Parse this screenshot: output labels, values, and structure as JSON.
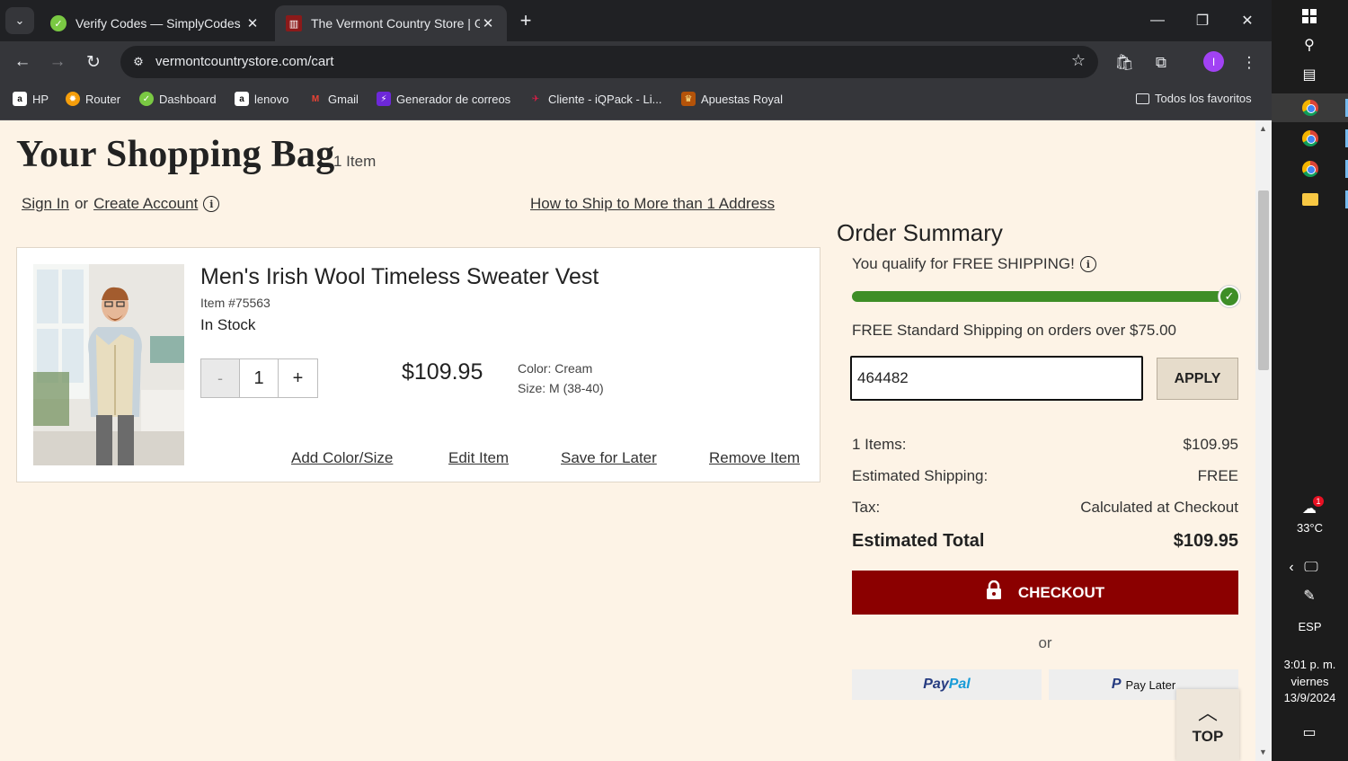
{
  "browser": {
    "tabs": [
      {
        "title": "Verify Codes — SimplyCodes",
        "favicon": "simplycodes-icon"
      },
      {
        "title": "The Vermont Country Store | Ge",
        "favicon": "vermont-store-icon"
      }
    ],
    "url": "vermontcountrystore.com/cart",
    "bookmarks": [
      {
        "label": "HP",
        "icon": "amazon-icon"
      },
      {
        "label": "Router",
        "icon": "router-icon"
      },
      {
        "label": "Dashboard",
        "icon": "simplycodes-icon"
      },
      {
        "label": "lenovo",
        "icon": "amazon-icon"
      },
      {
        "label": "Gmail",
        "icon": "gmail-icon"
      },
      {
        "label": "Generador de correos",
        "icon": "bolt-icon"
      },
      {
        "label": "Cliente - iQPack - Li...",
        "icon": "iqpack-icon"
      },
      {
        "label": "Apuestas Royal",
        "icon": "royal-icon"
      }
    ],
    "all_bookmarks": "Todos los favoritos",
    "profile_initial": "I"
  },
  "cart": {
    "title": "Your Shopping Bag",
    "count": "1 Item",
    "sign_in": "Sign In",
    "or": "or",
    "create_account": "Create Account",
    "ship_multi": "How to Ship to More than 1 Address",
    "item": {
      "name": "Men's Irish Wool Timeless Sweater Vest",
      "number": "Item #75563",
      "stock": "In Stock",
      "qty_minus": "-",
      "quantity": "1",
      "qty_plus": "+",
      "price": "$109.95",
      "color": "Color: Cream",
      "size": "Size: M (38-40)",
      "actions": [
        "Add Color/Size",
        "Edit Item",
        "Save for Later",
        "Remove Item"
      ]
    }
  },
  "summary": {
    "title": "Order Summary",
    "free_msg": "You qualify for FREE SHIPPING!",
    "progress_fraction": 1.0,
    "threshold": "FREE Standard Shipping on orders over $75.00",
    "promo_code": "464482",
    "apply": "APPLY",
    "items_label": "1 Items:",
    "items_value": "$109.95",
    "shipping_label": "Estimated Shipping:",
    "shipping_value": "FREE",
    "tax_label": "Tax:",
    "tax_value": "Calculated at Checkout",
    "total_label": "Estimated Total",
    "total_value": "$109.95",
    "checkout": "CHECKOUT",
    "or": "or",
    "paypal_a": "Pay",
    "paypal_b": "Pal",
    "pay_later": "Pay Later",
    "top": "TOP"
  },
  "taskbar": {
    "weather_badge": "1",
    "temperature": "33°C",
    "language": "ESP",
    "time": "3:01 p. m.",
    "day": "viernes",
    "date": "13/9/2024"
  },
  "colors": {
    "page_bg": "#fdf3e6",
    "checkout": "#8b0000",
    "progress": "#3e8e27",
    "paypal_dark": "#253b80",
    "paypal_light": "#179bd7"
  }
}
